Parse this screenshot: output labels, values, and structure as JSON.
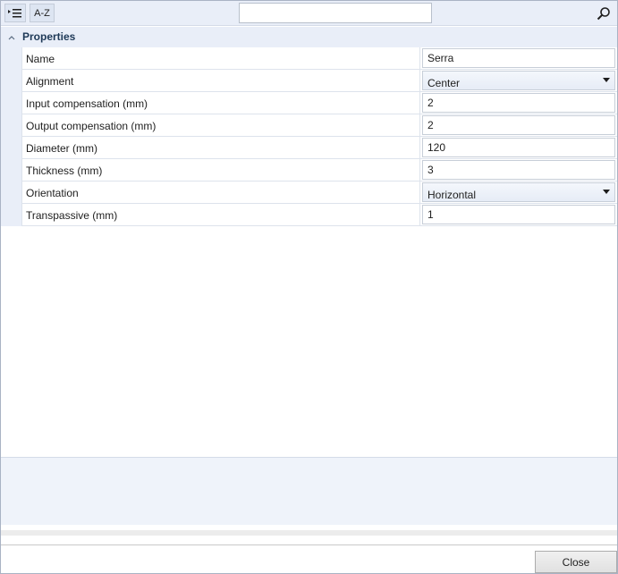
{
  "toolbar": {
    "categorized_icon": "categorized-list-icon",
    "az_label": "A-Z",
    "search": {
      "value": "",
      "placeholder": ""
    },
    "search_icon": "search-icon"
  },
  "category": {
    "label": "Properties",
    "expanded": true,
    "toggle_icon": "chevron-up-icon"
  },
  "properties": [
    {
      "label": "Name",
      "value": "Serra",
      "editor": "text"
    },
    {
      "label": "Alignment",
      "value": "Center",
      "editor": "combo"
    },
    {
      "label": "Input compensation (mm)",
      "value": "2",
      "editor": "text"
    },
    {
      "label": "Output compensation (mm)",
      "value": "2",
      "editor": "text"
    },
    {
      "label": "Diameter (mm)",
      "value": "120",
      "editor": "text"
    },
    {
      "label": "Thickness (mm)",
      "value": "3",
      "editor": "text"
    },
    {
      "label": "Orientation",
      "value": "Horizontal",
      "editor": "combo"
    },
    {
      "label": "Transpassive (mm)",
      "value": "1",
      "editor": "text"
    }
  ],
  "footer": {
    "close_label": "Close"
  },
  "colors": {
    "toolbar_bg": "#e9eef8",
    "description_bg": "#eff3fa",
    "category_text": "#1e3957"
  }
}
